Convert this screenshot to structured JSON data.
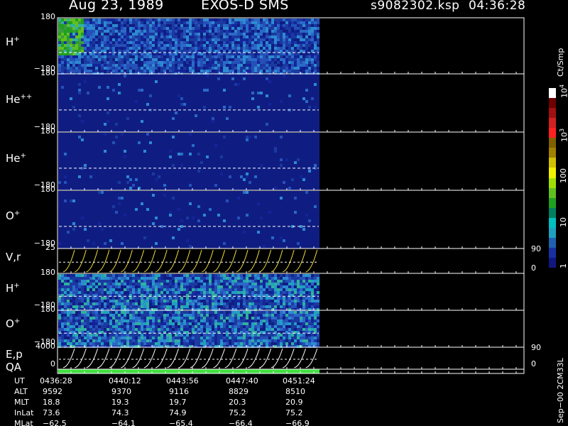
{
  "header": {
    "date": "Aug 23, 1989",
    "instrument": "EXOS-D SMS",
    "file": "s9082302.ksp",
    "time": "04:36:28"
  },
  "chart_data": {
    "type": "heatmap",
    "panels": [
      {
        "label": "H",
        "sup": "+",
        "ytop": "180",
        "ybot": "−180"
      },
      {
        "label": "He",
        "sup": "++",
        "ytop": "180",
        "ybot": "−180"
      },
      {
        "label": "He",
        "sup": "+",
        "ytop": "180",
        "ybot": "−180"
      },
      {
        "label": "O",
        "sup": "+",
        "ytop": "180",
        "ybot": "−180"
      },
      {
        "label": "V,r",
        "sup": "",
        "ytop": "25",
        "ybot": "",
        "right_top": "90",
        "right_bot": "0"
      },
      {
        "label": "H",
        "sup": "+",
        "ytop": "180",
        "ybot": "−180"
      },
      {
        "label": "O",
        "sup": "+",
        "ytop": "180",
        "ybot": "−180"
      },
      {
        "label": "E,p",
        "sup": "",
        "ytop": "4000",
        "ybot": "0",
        "right_top": "90",
        "right_bot": "0"
      },
      {
        "label": "QA",
        "sup": "",
        "ytop": "",
        "ybot": ""
      }
    ],
    "colorbar": {
      "unit": "Ct/Smp",
      "ticks": [
        {
          "text": "10",
          "sup": "4"
        },
        {
          "text": "10",
          "sup": "3"
        },
        {
          "text": "100",
          "sup": ""
        },
        {
          "text": "10",
          "sup": ""
        },
        {
          "text": "1",
          "sup": ""
        }
      ],
      "colors": [
        "#ffffff",
        "#6e0000",
        "#a01010",
        "#d02020",
        "#ff2020",
        "#806000",
        "#a08000",
        "#d0c000",
        "#f0f000",
        "#a0e000",
        "#60c020",
        "#20a020",
        "#008060",
        "#00c0c0",
        "#20a0c0",
        "#2060b0",
        "#1830a0",
        "#101880"
      ]
    },
    "data_fraction": 0.56,
    "utc_table": {
      "row_labels": [
        "UT",
        "ALT",
        "MLT",
        "InLat",
        "MLat"
      ],
      "columns": [
        [
          "0436:28",
          "9592",
          "18.8",
          "73.6",
          "−62.5"
        ],
        [
          "0440:12",
          "9370",
          "19.3",
          "74.3",
          "−64.1"
        ],
        [
          "0443:56",
          "9116",
          "19.7",
          "74.9",
          "−65.4"
        ],
        [
          "0447:40",
          "8829",
          "20.3",
          "75.2",
          "−66.4"
        ],
        [
          "0451:24",
          "8510",
          "20.9",
          "75.2",
          "−66.9"
        ]
      ]
    },
    "footer_side": "Sep−00 2CM33L"
  }
}
